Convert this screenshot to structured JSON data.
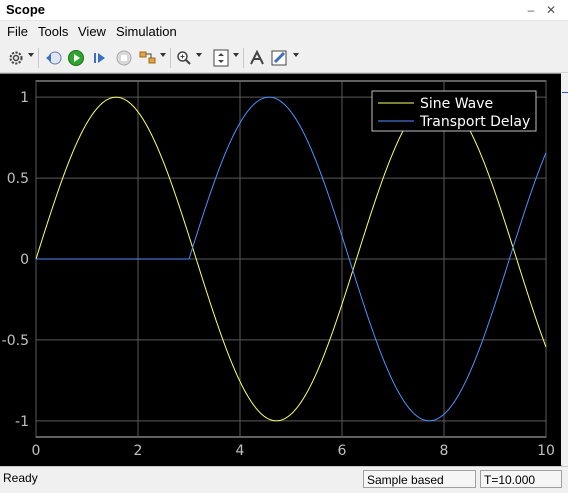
{
  "window": {
    "title": "Scope",
    "minimize": "–",
    "close": "✕"
  },
  "menu": [
    "File",
    "Tools",
    "View",
    "Simulation"
  ],
  "toolbar": {
    "icons": [
      "gear-icon",
      "step-back-icon",
      "run-icon",
      "step-forward-icon",
      "stop-icon",
      "highlight-icon",
      "zoom-icon",
      "scale-axes-icon",
      "cursor-icon",
      "style-icon"
    ]
  },
  "colors": {
    "sine": "#ffff66",
    "delay": "#4d90fe",
    "grid": "#5a5a5a",
    "axis": "#c0c0c0",
    "run_green": "#2fa52f"
  },
  "chart_data": {
    "type": "line",
    "xlim": [
      0,
      10
    ],
    "ylim": [
      -1.1,
      1.1
    ],
    "x_ticks": [
      "0",
      "2",
      "4",
      "6",
      "8",
      "10"
    ],
    "y_ticks": [
      "1",
      "0.5",
      "0",
      "-0.5",
      "-1"
    ],
    "grid": true,
    "legend_position": "top-right",
    "series": [
      {
        "name": "Sine Wave",
        "function": "sin(t)",
        "color": "#ffff66"
      },
      {
        "name": "Transport Delay",
        "function": "sin(t-3) for t>=3, else 0",
        "delay": 3,
        "color": "#4d90fe"
      }
    ],
    "samples": {
      "x": [
        0,
        1,
        2,
        3,
        4,
        5,
        6,
        7,
        8,
        9,
        10
      ],
      "sine_wave": [
        0,
        0.841,
        0.909,
        0.141,
        -0.757,
        -0.959,
        -0.279,
        0.657,
        0.989,
        0.412,
        -0.544
      ],
      "transport_delay": [
        0,
        0,
        0,
        0,
        0.841,
        0.909,
        0.141,
        -0.757,
        -0.959,
        -0.279,
        0.657
      ]
    }
  },
  "status": {
    "left": "Ready",
    "mode": "Sample based",
    "time": "T=10.000"
  }
}
